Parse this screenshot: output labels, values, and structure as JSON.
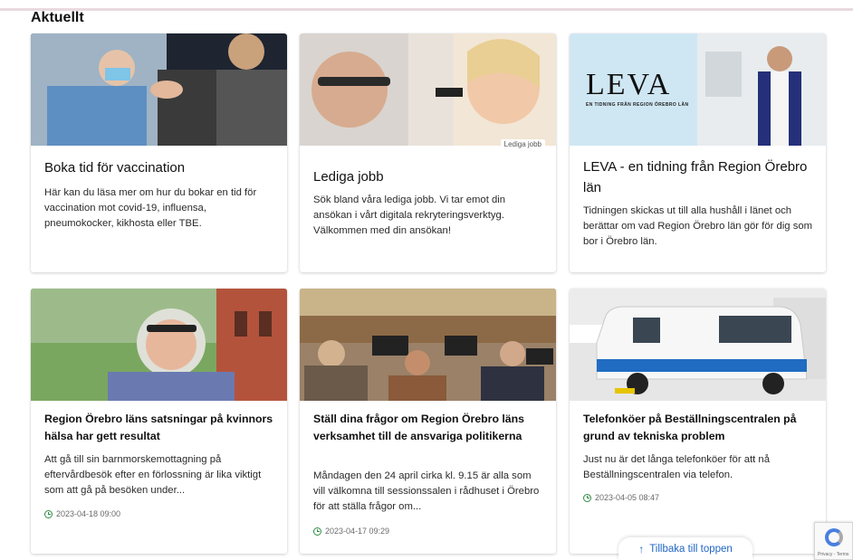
{
  "section": {
    "title": "Aktuellt"
  },
  "cards": [
    {
      "title": "Boka tid för vaccination",
      "body": "Här kan du läsa mer om hur du bokar en tid för vaccination mot covid-19, influensa, pneumokocker, kikhosta eller TBE."
    },
    {
      "title": "Lediga jobb",
      "image_caption": "Lediga jobb",
      "body": "Sök bland våra lediga jobb. Vi tar emot din ansökan i vårt digitala rekryteringsverktyg. Välkommen med din ansökan!"
    },
    {
      "title": "LEVA - en tidning från Region Örebro län",
      "image_logo": "LEVA",
      "image_logo_sub": "EN TIDNING FRÅN REGION ÖREBRO LÄN",
      "body": "Tidningen skickas ut till alla hushåll i länet och berättar om vad Region Örebro län gör för dig som bor i Örebro län."
    },
    {
      "title": "Region Örebro läns satsningar på kvinnors hälsa har gett resultat",
      "body": "Att gå till sin barnmorskemottagning på eftervårdbesök efter en förlossning är lika viktigt som att gå på besöken under...",
      "date": "2023-04-18 09:00"
    },
    {
      "title": "Ställ dina frågor om Region Örebro läns verksamhet till de ansvariga politikerna",
      "body": "Måndagen den 24 april cirka kl. 9.15 är alla som vill välkomna till sessionssalen i rådhuset i Örebro för att ställa frågor om...",
      "date": "2023-04-17 09:29"
    },
    {
      "title": "Telefonköer på Beställningscentralen på grund av tekniska problem",
      "body": "Just nu är det långa telefonköer för att nå Beställningscentralen via telefon.",
      "date": "2023-04-05 08:47"
    }
  ],
  "back_to_top": {
    "label": "Tillbaka till toppen",
    "icon": "arrow-up-icon"
  },
  "captcha": {
    "label": "Privacy - Terms"
  }
}
